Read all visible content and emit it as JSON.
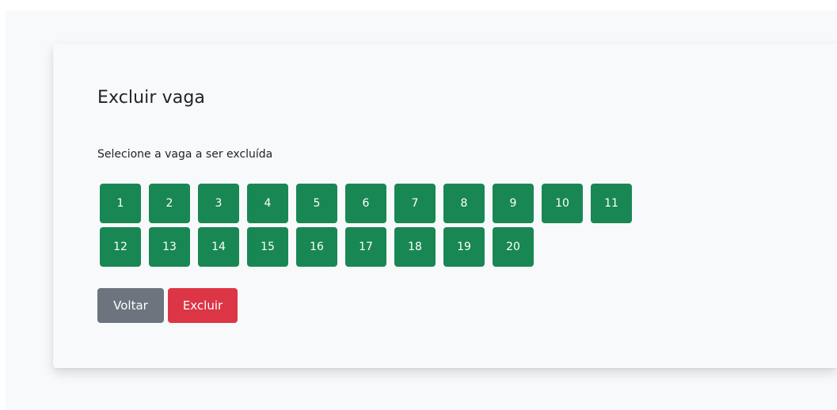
{
  "panel": {
    "title": "Excluir vaga",
    "subtitle": "Selecione a vaga a ser excluída"
  },
  "slots": [
    "1",
    "2",
    "3",
    "4",
    "5",
    "6",
    "7",
    "8",
    "9",
    "10",
    "11",
    "12",
    "13",
    "14",
    "15",
    "16",
    "17",
    "18",
    "19",
    "20"
  ],
  "actions": {
    "back_label": "Voltar",
    "delete_label": "Excluir"
  },
  "colors": {
    "slot": "#198754",
    "back": "#6c757d",
    "delete": "#dc3545",
    "background": "#f8f9fa"
  }
}
